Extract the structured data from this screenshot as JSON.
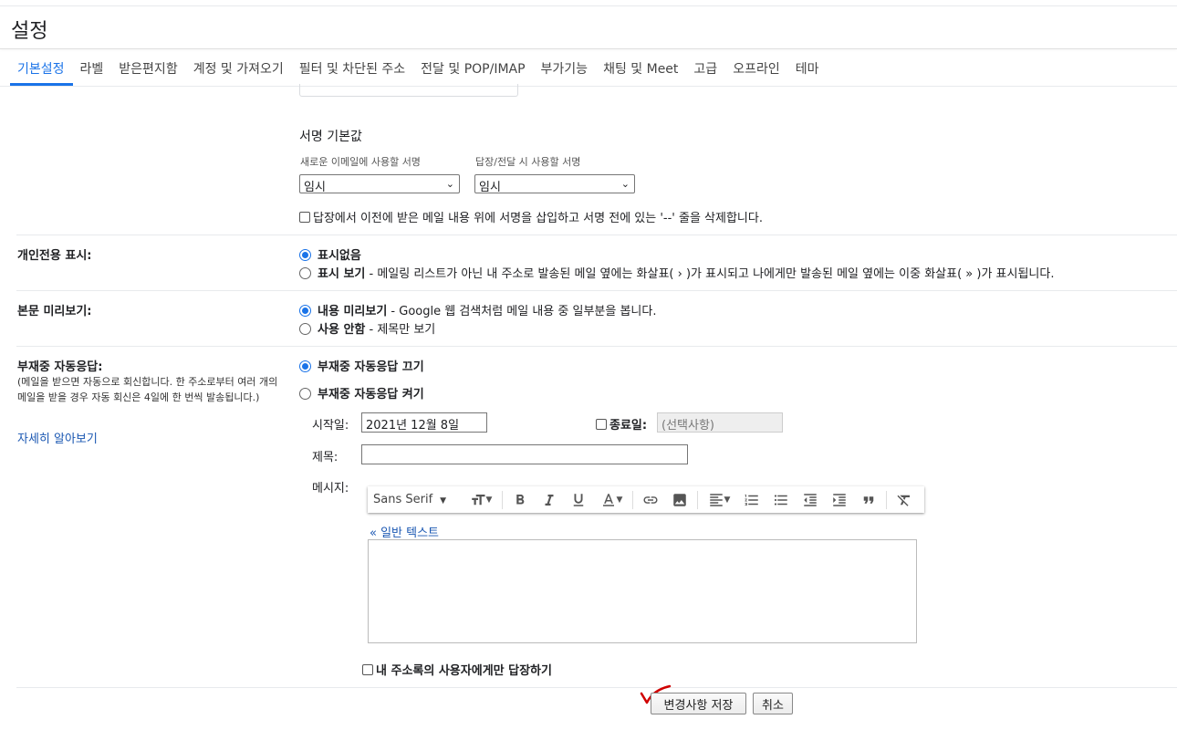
{
  "page_title": "설정",
  "tabs": [
    {
      "label": "기본설정",
      "active": true
    },
    {
      "label": "라벨"
    },
    {
      "label": "받은편지함"
    },
    {
      "label": "계정 및 가져오기"
    },
    {
      "label": "필터 및 차단된 주소"
    },
    {
      "label": "전달 및 POP/IMAP"
    },
    {
      "label": "부가기능"
    },
    {
      "label": "채팅 및 Meet"
    },
    {
      "label": "고급"
    },
    {
      "label": "오프라인"
    },
    {
      "label": "테마"
    }
  ],
  "signature": {
    "title": "서명 기본값",
    "new_email_label": "새로운 이메일에 사용할 서명",
    "reply_label": "답장/전달 시 사용할 서명",
    "new_email_value": "임시",
    "reply_value": "임시",
    "insert_before_text": "답장에서 이전에 받은 메일 내용 위에 서명을 삽입하고 서명 전에 있는 '--' 줄을 삭제합니다."
  },
  "personal_indicator": {
    "label": "개인전용 표시:",
    "opt1": "표시없음",
    "opt2_bold": "표시 보기",
    "opt2_desc": " - 메일링 리스트가 아닌 내 주소로 발송된 메일 옆에는 화살표( › )가 표시되고 나에게만 발송된 메일 옆에는 이중 화살표( » )가 표시됩니다."
  },
  "preview": {
    "label": "본문 미리보기:",
    "opt1_bold": "내용 미리보기",
    "opt1_desc": " - Google 웹 검색처럼 메일 내용 중 일부분을 봅니다.",
    "opt2_bold": "사용 안함",
    "opt2_desc": " - 제목만 보기"
  },
  "vacation": {
    "label": "부재중 자동응답:",
    "desc": "(메일을 받으면 자동으로 회신합니다. 한 주소로부터 여러 개의 메일을 받을 경우 자동 회신은 4일에 한 번씩 발송됩니다.)",
    "learn_more": "자세히 알아보기",
    "off_label": "부재중 자동응답 끄기",
    "on_label": "부재중 자동응답 켜기",
    "start_label": "시작일:",
    "start_value": "2021년 12월 8일",
    "end_label": "종료일:",
    "end_placeholder": "(선택사항)",
    "subject_label": "제목:",
    "message_label": "메시지:",
    "font_name": "Sans Serif",
    "plain_text_link": "« 일반 텍스트",
    "contacts_only": "내 주소록의 사용자에게만 답장하기"
  },
  "buttons": {
    "save": "변경사항 저장",
    "cancel": "취소"
  },
  "colors": {
    "accent": "#1a73e8",
    "link": "#1a57b2",
    "annotation": "#d00000"
  }
}
